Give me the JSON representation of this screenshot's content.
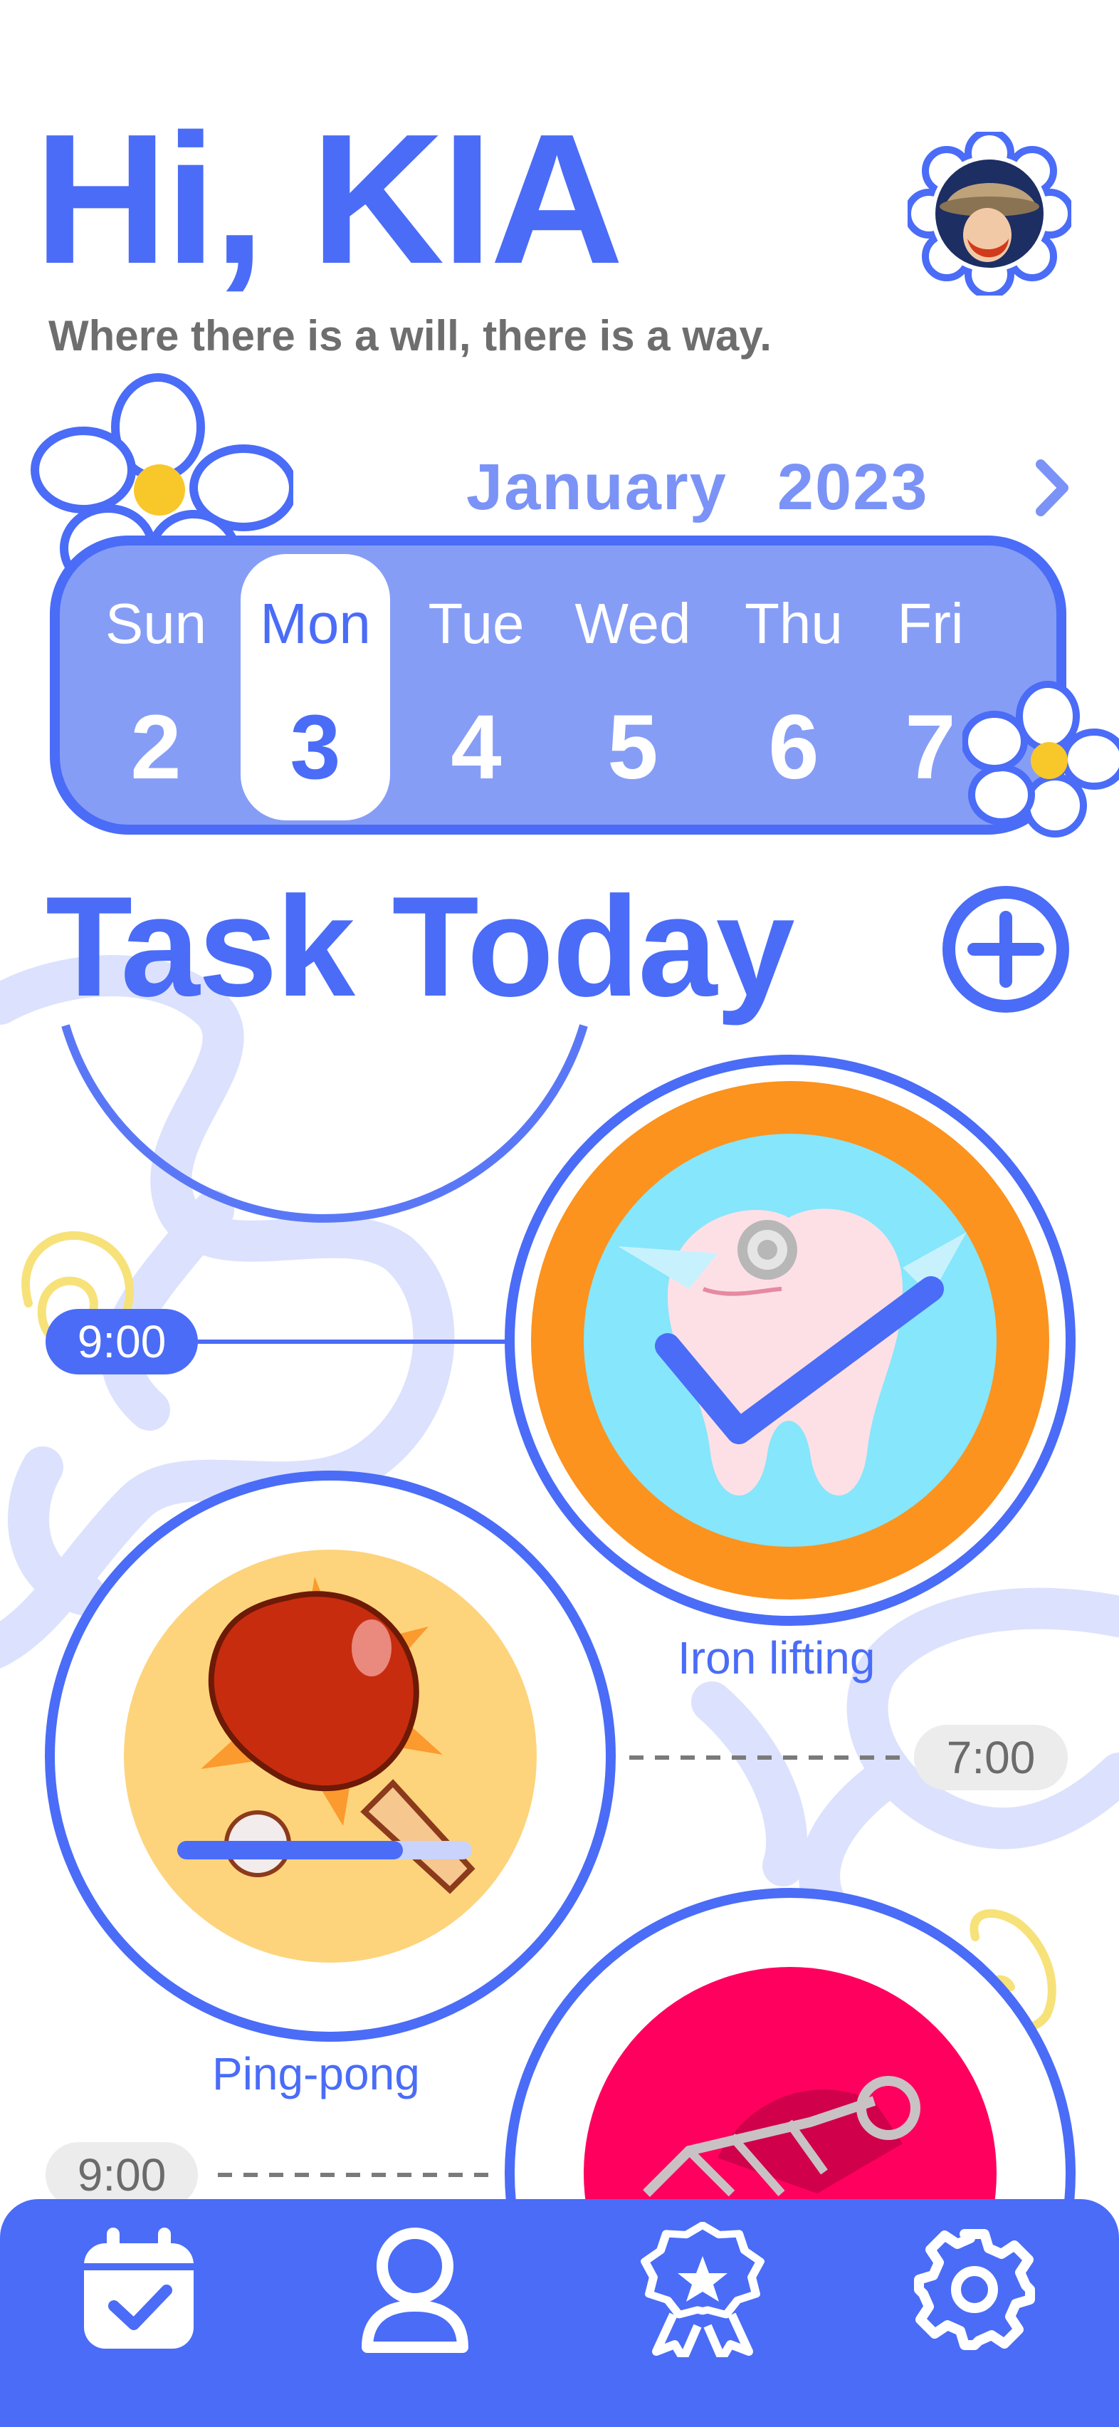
{
  "header": {
    "greeting": "Hi, KIA",
    "quote": "Where there is a will, there is a way.",
    "avatar_icon": "avatar-portrait"
  },
  "calendar": {
    "month": "January",
    "year": "2023",
    "next_icon": "chevron-right-icon",
    "days": [
      {
        "name": "Sun",
        "date": "2",
        "selected": false
      },
      {
        "name": "Mon",
        "date": "3",
        "selected": true
      },
      {
        "name": "Tue",
        "date": "4",
        "selected": false
      },
      {
        "name": "Wed",
        "date": "5",
        "selected": false
      },
      {
        "name": "Thu",
        "date": "6",
        "selected": false
      },
      {
        "name": "Fri",
        "date": "7",
        "selected": false
      }
    ]
  },
  "tasks": {
    "title": "Task Today",
    "add_icon": "plus-circle-icon",
    "items": [
      {
        "name": "Iron lifting",
        "time": "9:00",
        "done": true,
        "icon": "tooth-icon",
        "color": "#fb931e"
      },
      {
        "name": "Ping-pong",
        "time": "7:00",
        "done": false,
        "icon": "ping-pong-paddle-icon",
        "color": "#fdd47c",
        "progress": 0.75
      },
      {
        "name": "",
        "time": "9:00",
        "done": false,
        "icon": "shuttlecock-icon",
        "color": "#ff005f"
      }
    ]
  },
  "tabbar": {
    "items": [
      {
        "name": "calendar-check-icon"
      },
      {
        "name": "user-icon"
      },
      {
        "name": "award-badge-icon"
      },
      {
        "name": "gear-icon"
      }
    ]
  },
  "colors": {
    "primary": "#4a6cf7",
    "calendar_fill": "#869df6",
    "pale_blue": "#dde3fd",
    "accent_yellow": "#f6c831"
  }
}
